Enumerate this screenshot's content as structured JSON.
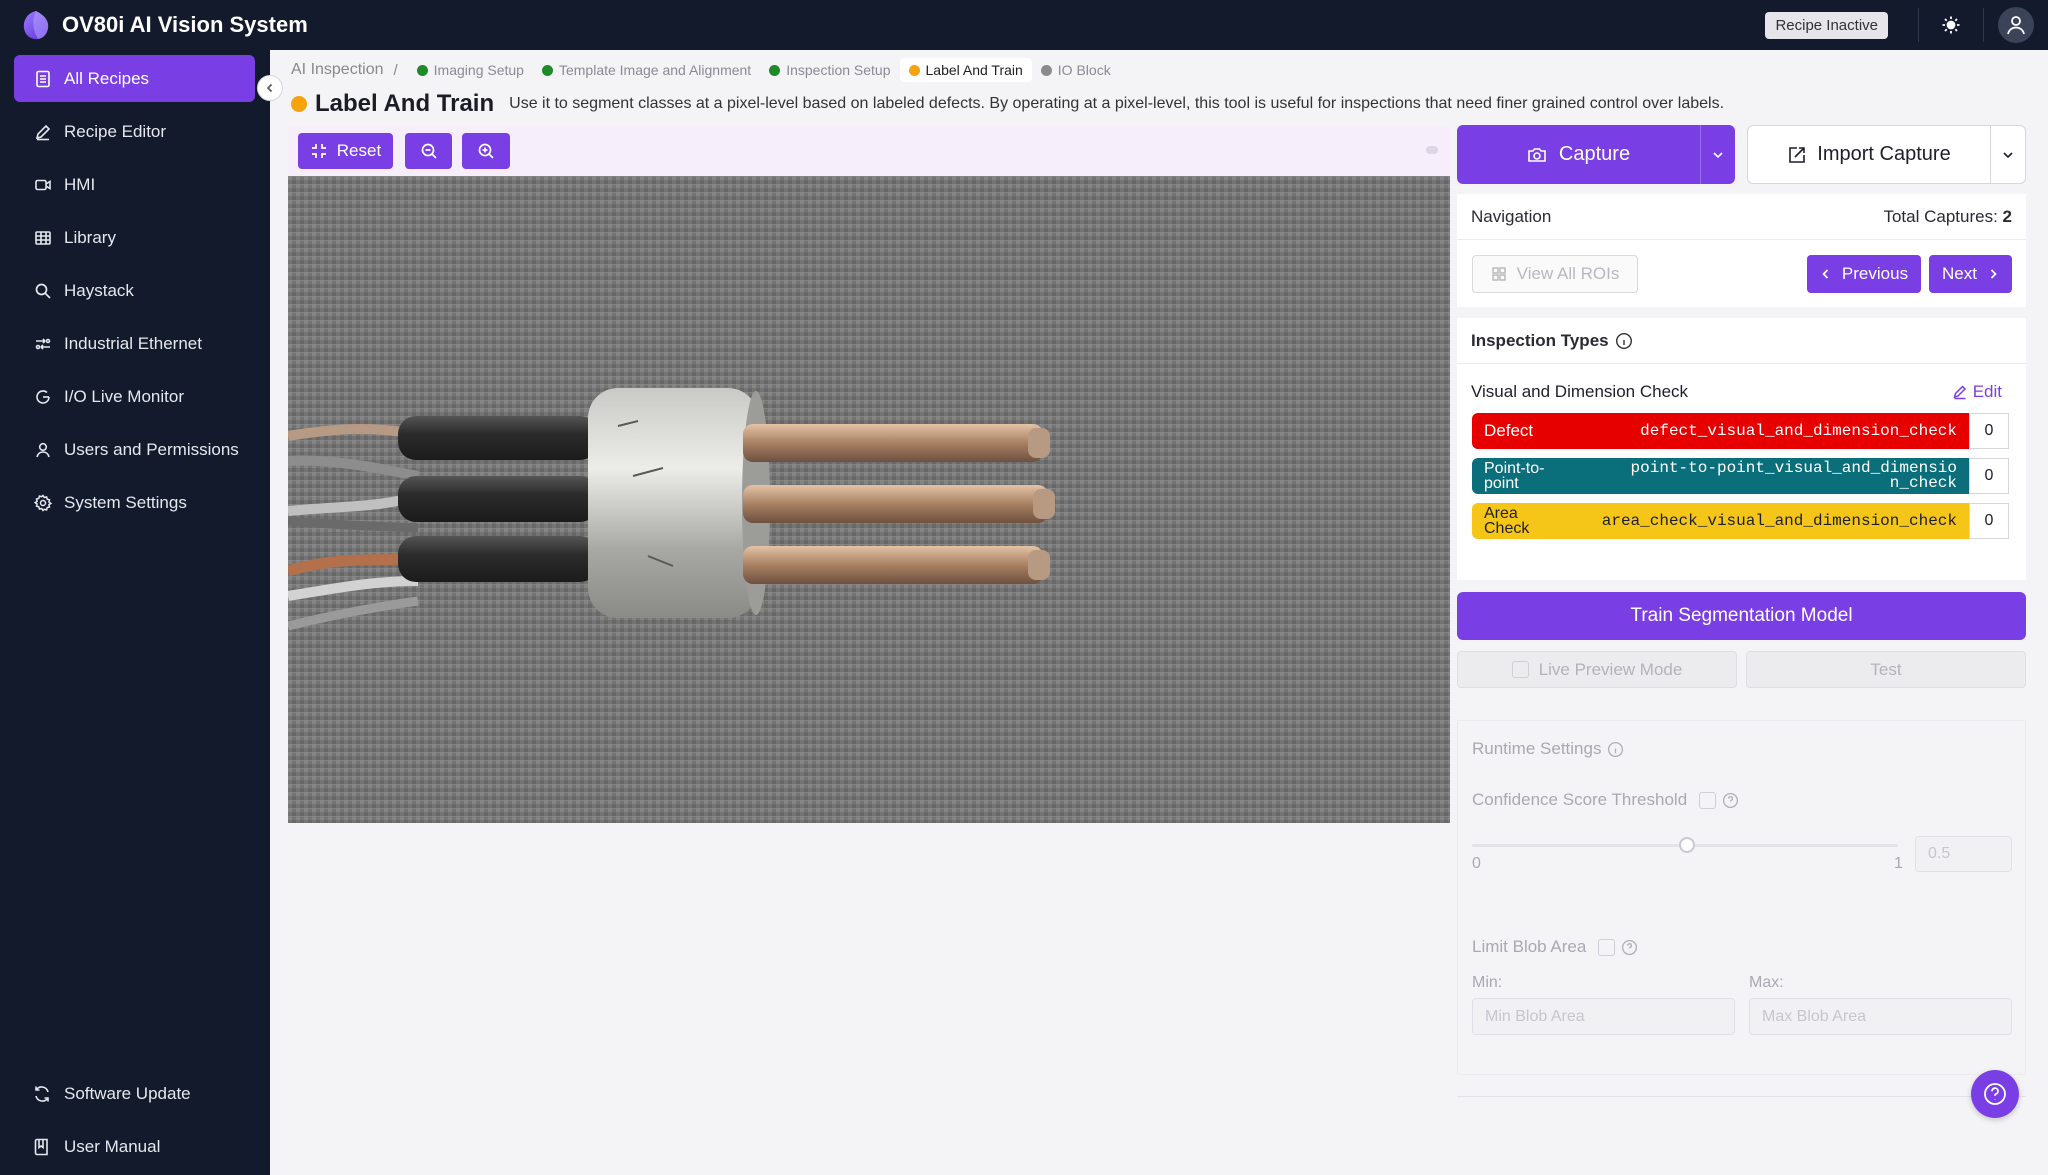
{
  "app": {
    "title": "OV80i AI Vision System",
    "recipe_status": "Recipe Inactive"
  },
  "sidebar": {
    "items": [
      {
        "label": "All Recipes",
        "icon": "document-list-icon",
        "active": true
      },
      {
        "label": "Recipe Editor",
        "icon": "pencil-icon"
      },
      {
        "label": "HMI",
        "icon": "video-icon"
      },
      {
        "label": "Library",
        "icon": "grid-table-icon"
      },
      {
        "label": "Haystack",
        "icon": "search-icon"
      },
      {
        "label": "Industrial Ethernet",
        "icon": "network-icon"
      },
      {
        "label": "I/O Live Monitor",
        "icon": "monitor-gauge-icon"
      },
      {
        "label": "Users and Permissions",
        "icon": "user-icon"
      },
      {
        "label": "System Settings",
        "icon": "gear-icon"
      }
    ],
    "footer": [
      {
        "label": "Software Update",
        "icon": "refresh-icon"
      },
      {
        "label": "User Manual",
        "icon": "book-icon"
      }
    ]
  },
  "breadcrumb": {
    "root": "AI Inspection",
    "sep": "/",
    "steps": [
      {
        "label": "Imaging Setup",
        "color": "#1e8a2a"
      },
      {
        "label": "Template Image and Alignment",
        "color": "#1e8a2a"
      },
      {
        "label": "Inspection Setup",
        "color": "#1e8a2a"
      },
      {
        "label": "Label And Train",
        "color": "#f5a30c",
        "current": true
      },
      {
        "label": "IO Block",
        "color": "#8a8a8a"
      }
    ]
  },
  "page": {
    "title": "Label And Train",
    "status_color": "#f5a30c",
    "description": "Use it to segment classes at a pixel-level based on labeled defects. By operating at a pixel-level, this tool is useful for inspections that need finer grained control over labels."
  },
  "toolbar": {
    "reset_label": "Reset"
  },
  "capture": {
    "label": "Capture",
    "import_label": "Import Capture"
  },
  "navigation": {
    "title": "Navigation",
    "total_label": "Total Captures:",
    "total_value": "2",
    "view_all_label": "View All ROIs",
    "previous_label": "Previous",
    "next_label": "Next"
  },
  "inspection_types": {
    "title": "Inspection Types",
    "group_name": "Visual and Dimension Check",
    "edit_label": "Edit",
    "classes": [
      {
        "name": "Defect",
        "id": "defect_visual_and_dimension_check",
        "count": "0",
        "color": "#e60000",
        "text_color": "#ffffff"
      },
      {
        "name": "Point-to-point",
        "id": "point-to-point_visual_and_dimension_check",
        "count": "0",
        "color": "#0b6f7b",
        "text_color": "#ffffff"
      },
      {
        "name": "Area Check",
        "id": "area_check_visual_and_dimension_check",
        "count": "0",
        "color": "#f5c518",
        "text_color": "#1f1f2b"
      }
    ]
  },
  "train": {
    "label": "Train Segmentation Model",
    "live_preview_label": "Live Preview Mode",
    "test_label": "Test"
  },
  "runtime": {
    "title": "Runtime Settings",
    "confidence_label": "Confidence Score Threshold",
    "slider_min": "0",
    "slider_max": "1",
    "threshold_value": "0.5",
    "limit_blob_label": "Limit Blob Area",
    "min_label": "Min:",
    "max_label": "Max:",
    "min_placeholder": "Min Blob Area",
    "max_placeholder": "Max Blob Area"
  },
  "colors": {
    "accent": "#7a3fe4",
    "sidebar_bg": "#121a2c"
  }
}
